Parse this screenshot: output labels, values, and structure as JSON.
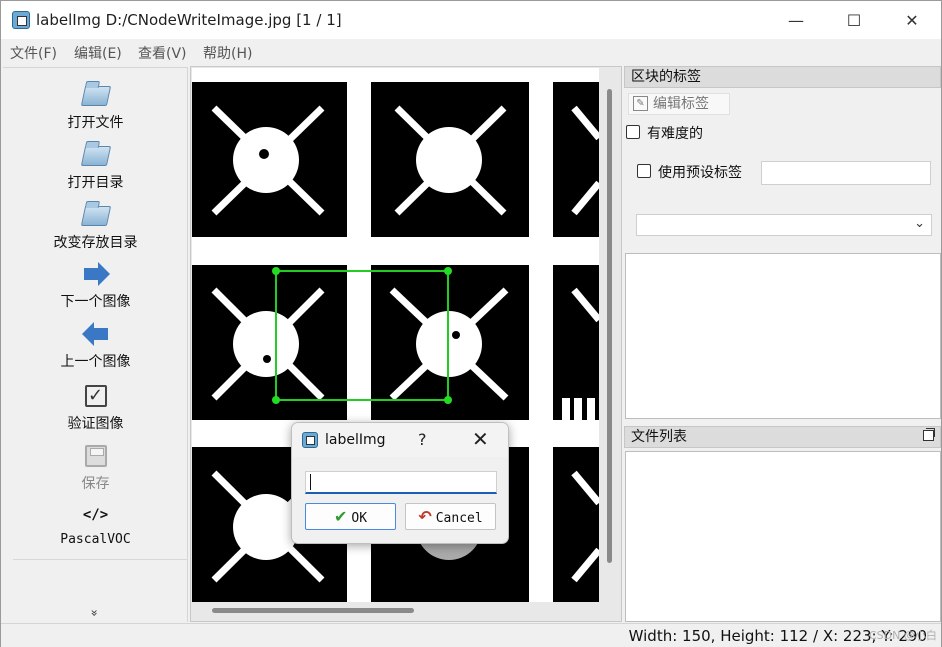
{
  "window": {
    "title": "labelImg D:/CNodeWriteImage.jpg [1 / 1]",
    "minimize_glyph": "—",
    "maximize_glyph": "☐",
    "close_glyph": "✕"
  },
  "menu": {
    "items": [
      "文件(F)",
      "编辑(E)",
      "查看(V)",
      "帮助(H)"
    ]
  },
  "toolbar": {
    "open_file": "打开文件",
    "open_dir": "打开目录",
    "change_save_dir": "改变存放目录",
    "next_image": "下一个图像",
    "prev_image": "上一个图像",
    "verify_image": "验证图像",
    "save": "保存",
    "format_glyph": "</>",
    "format": "PascalVOC",
    "more_glyph": "»"
  },
  "box_labels_dock": {
    "title": "区块的标签",
    "edit_label": "编辑标签",
    "difficult": "有难度的",
    "difficult_checked": false,
    "use_default_label": "使用预设标签",
    "use_default_checked": false,
    "default_label_value": "",
    "combo_value": ""
  },
  "file_list_dock": {
    "title": "文件列表"
  },
  "dialog": {
    "title": "labelImg",
    "help": "?",
    "close": "✕",
    "input_value": "",
    "ok": "OK",
    "cancel": "Cancel"
  },
  "status": {
    "text": "Width: 150, Height: 112 / X: 223; Y: 290"
  },
  "watermark": "CSDN @小白",
  "colors": {
    "bbox": "#22cc22",
    "bbox_handle": "#22dd22",
    "accent": "#1a5fb4"
  }
}
